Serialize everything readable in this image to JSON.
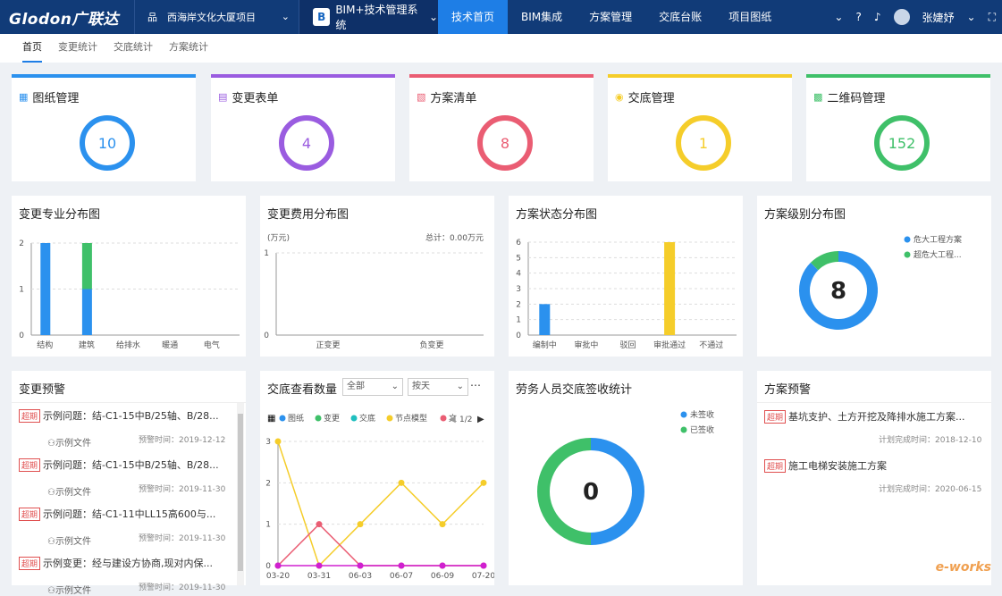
{
  "topbar": {
    "logo": "Glodon广联达",
    "project": "西海岸文化大厦项目",
    "system": "BIM+技术管理系统",
    "system_icon": "B",
    "nav": [
      "技术首页",
      "BIM集成",
      "方案管理",
      "交底台账",
      "项目图纸"
    ],
    "user": "张婕妤"
  },
  "subnav": [
    "首页",
    "变更统计",
    "交底统计",
    "方案统计"
  ],
  "stats": [
    {
      "title": "图纸管理",
      "value": "10",
      "color": "#2b91ee"
    },
    {
      "title": "变更表单",
      "value": "4",
      "color": "#9a5ce0"
    },
    {
      "title": "方案清单",
      "value": "8",
      "color": "#ea5d73"
    },
    {
      "title": "交底管理",
      "value": "1",
      "color": "#f5cd2a"
    },
    {
      "title": "二维码管理",
      "value": "152",
      "color": "#3fc069"
    }
  ],
  "panels": {
    "change_major": "变更专业分布图",
    "change_cost": "变更费用分布图",
    "plan_status": "方案状态分布图",
    "plan_level": "方案级别分布图",
    "change_warn": "变更预警",
    "brief_views": "交底查看数量",
    "labor_sign": "劳务人员交底签收统计",
    "plan_warn": "方案预警"
  },
  "chart_data": [
    {
      "type": "bar",
      "title": "变更专业分布图",
      "categories": [
        "结构",
        "建筑",
        "给排水",
        "暖通",
        "电气"
      ],
      "series": [
        {
          "values": [
            2,
            1,
            0,
            0,
            0
          ],
          "color": "#2b91ee"
        },
        {
          "values": [
            0,
            1,
            0,
            0,
            0
          ],
          "color": "#3fc069"
        }
      ],
      "ylim": [
        0,
        2
      ],
      "yticks": [
        "0",
        "1",
        "2"
      ]
    },
    {
      "type": "bar",
      "title": "变更费用分布图",
      "unit": "(万元)",
      "total": "总计：0.00万元",
      "categories": [
        "正变更",
        "负变更"
      ],
      "values": [
        0,
        0
      ],
      "ylim": [
        0,
        1
      ],
      "yticks": [
        "0",
        "1"
      ]
    },
    {
      "type": "bar",
      "title": "方案状态分布图",
      "categories": [
        "编制中",
        "审批中",
        "驳回",
        "审批通过",
        "不通过"
      ],
      "values": [
        2,
        0,
        0,
        6,
        0
      ],
      "colors": [
        "#2b91ee",
        "#2b91ee",
        "#2b91ee",
        "#f5cd2a",
        "#2b91ee"
      ],
      "ylim": [
        0,
        6
      ],
      "yticks": [
        "0",
        "1",
        "2",
        "3",
        "4",
        "5",
        "6"
      ]
    },
    {
      "type": "pie",
      "title": "方案级别分布图",
      "center": "8",
      "legend": [
        "危大工程方案",
        "超危大工程..."
      ],
      "values": [
        7,
        1
      ],
      "colors": [
        "#2b91ee",
        "#3fc069"
      ]
    },
    {
      "type": "line",
      "title": "交底查看数量",
      "filter1": "全部",
      "filter2": "按天",
      "page": "1/2",
      "legend": [
        "图纸",
        "变更",
        "交底",
        "节点模型",
        "文"
      ],
      "x": [
        "03-20",
        "03-31",
        "06-03",
        "06-07",
        "06-09",
        "07-20"
      ],
      "series": [
        {
          "name": "节点模型",
          "values": [
            3,
            0,
            1,
            2,
            1,
            2
          ],
          "color": "#f5cd2a"
        },
        {
          "name": "文",
          "values": [
            0,
            1,
            0,
            0,
            0,
            0
          ],
          "color": "#ea5d73"
        },
        {
          "name": "图纸",
          "values": [
            0,
            0,
            0,
            0,
            0,
            0
          ],
          "color": "#d020d0"
        }
      ],
      "ylim": [
        0,
        3
      ],
      "yticks": [
        "0",
        "1",
        "2",
        "3"
      ],
      "legend_colors": [
        "#2b91ee",
        "#3fc069",
        "#1fbfbf",
        "#f5cd2a",
        "#ea5d73"
      ]
    },
    {
      "type": "pie",
      "title": "劳务人员交底签收统计",
      "center": "0",
      "legend": [
        "未签收",
        "已签收"
      ],
      "values": [
        1,
        1
      ],
      "colors": [
        "#2b91ee",
        "#3fc069"
      ]
    }
  ],
  "change_warn": [
    {
      "tag": "超期",
      "title": "示例问题：结-C1-15中B/25轴、B/28...",
      "sub": "示例文件",
      "date": "预警时间：2019-12-12"
    },
    {
      "tag": "超期",
      "title": "示例问题：结-C1-15中B/25轴、B/28...",
      "sub": "示例文件",
      "date": "预警时间：2019-11-30"
    },
    {
      "tag": "超期",
      "title": "示例问题：结-C1-11中LL15高600与...",
      "sub": "示例文件",
      "date": "预警时间：2019-11-30"
    },
    {
      "tag": "超期",
      "title": "示例变更：经与建设方协商,现对内保...",
      "sub": "示例文件",
      "date": "预警时间：2019-11-30"
    }
  ],
  "plan_warn": [
    {
      "tag": "超期",
      "title": "基坑支护、土方开挖及降排水施工方案...",
      "date": "计划完成时间：2018-12-10"
    },
    {
      "tag": "超期",
      "title": "施工电梯安装施工方案",
      "date": "计划完成时间：2020-06-15"
    }
  ],
  "watermark": "e-works"
}
